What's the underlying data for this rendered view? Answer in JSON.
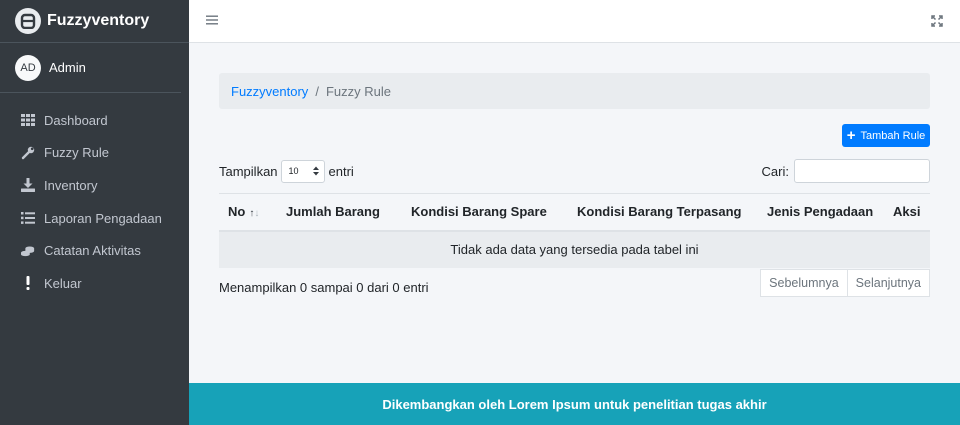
{
  "brand": {
    "name": "Fuzzyventory",
    "logo_icon": "fuzzyventory-logo-icon"
  },
  "user": {
    "initials": "AD",
    "name": "Admin"
  },
  "sidebar": {
    "items": [
      {
        "label": "Dashboard",
        "icon": "grid-icon"
      },
      {
        "label": "Fuzzy Rule",
        "icon": "wrench-icon"
      },
      {
        "label": "Inventory",
        "icon": "download-icon"
      },
      {
        "label": "Laporan Pengadaan",
        "icon": "list-icon"
      },
      {
        "label": "Catatan Aktivitas",
        "icon": "coins-icon"
      },
      {
        "label": "Keluar",
        "icon": "exclamation-icon"
      }
    ]
  },
  "breadcrumb": {
    "root": "Fuzzyventory",
    "separator": "/",
    "current": "Fuzzy Rule"
  },
  "toolbar": {
    "add_label": "Tambah Rule"
  },
  "table_controls": {
    "show_prefix": "Tampilkan",
    "page_length": "10",
    "show_suffix": "entri",
    "search_label": "Cari:"
  },
  "table": {
    "columns": [
      "No",
      "Jumlah Barang",
      "Kondisi Barang Spare",
      "Kondisi Barang Terpasang",
      "Jenis Pengadaan",
      "Aksi"
    ],
    "empty_message": "Tidak ada data yang tersedia pada tabel ini"
  },
  "info": "Menampilkan 0 sampai 0 dari 0 entri",
  "pagination": {
    "prev": "Sebelumnya",
    "next": "Selanjutnya"
  },
  "footer": "Dikembangkan oleh Lorem Ipsum untuk penelitian tugas akhir",
  "colors": {
    "sidebar": "#343a40",
    "primary": "#007bff",
    "footer": "#17a2b8"
  }
}
